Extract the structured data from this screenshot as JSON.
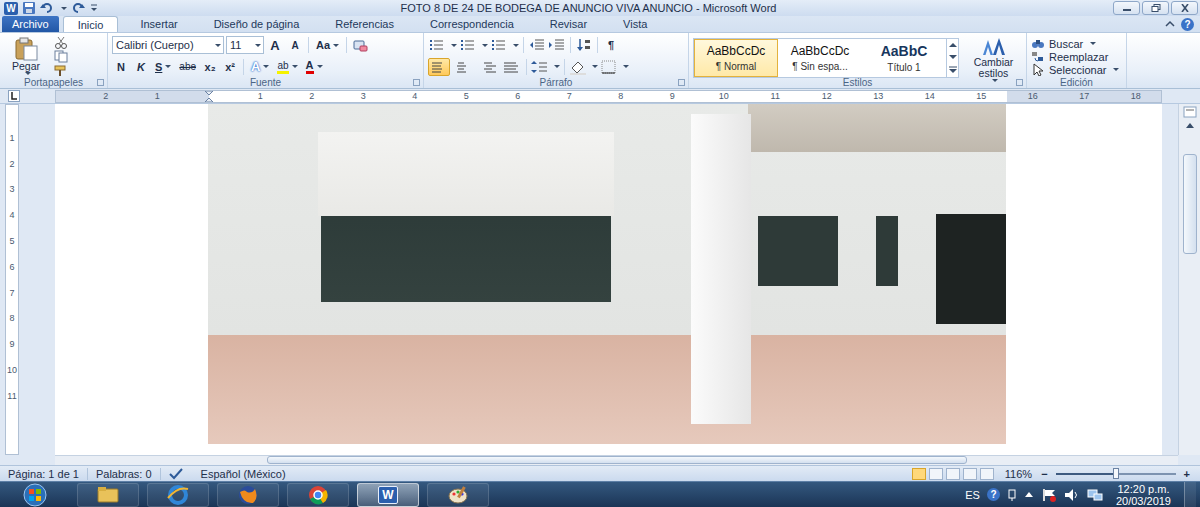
{
  "window": {
    "title": "FOTO 8 DE 24 DE BODEGA DE ANUNCIO VIVA ANUNCIO - Microsoft Word",
    "logo": "W",
    "help": "?"
  },
  "tabs": [
    {
      "label": "Archivo",
      "kind": "file",
      "selected": false
    },
    {
      "label": "Inicio",
      "kind": "tab",
      "selected": true
    },
    {
      "label": "Insertar",
      "kind": "tab",
      "selected": false
    },
    {
      "label": "Diseño de página",
      "kind": "tab",
      "selected": false
    },
    {
      "label": "Referencias",
      "kind": "tab",
      "selected": false
    },
    {
      "label": "Correspondencia",
      "kind": "tab",
      "selected": false
    },
    {
      "label": "Revisar",
      "kind": "tab",
      "selected": false
    },
    {
      "label": "Vista",
      "kind": "tab",
      "selected": false
    }
  ],
  "ribbon": {
    "clipboard": {
      "label": "Portapapeles",
      "paste": "Pegar"
    },
    "font": {
      "label": "Fuente",
      "name": "Calibri (Cuerpo)",
      "size": "11",
      "grow": "A",
      "shrink": "A",
      "case": "Aa",
      "bold": "N",
      "italic": "K",
      "underline": "S",
      "strike": "abe",
      "subscript": "x₂",
      "superscript": "x²",
      "effects": "A",
      "highlight": "ab",
      "color": "A"
    },
    "paragraph": {
      "label": "Párrafo",
      "marks": "¶",
      "align": [
        {
          "selected": true
        },
        {
          "selected": false
        },
        {
          "selected": false
        },
        {
          "selected": false
        }
      ]
    },
    "styles": {
      "label": "Estilos",
      "items": [
        {
          "preview": "AaBbCcDc",
          "name": "¶ Normal",
          "selected": true
        },
        {
          "preview": "AaBbCcDc",
          "name": "¶ Sin espa...",
          "selected": false
        },
        {
          "preview": "AaBbC",
          "name": "Título 1",
          "selected": false
        }
      ],
      "change": "Cambiar estilos"
    },
    "editing": {
      "label": "Edición",
      "find": "Buscar",
      "replace": "Reemplazar",
      "select": "Seleccionar"
    }
  },
  "ruler": {
    "h": [
      "2",
      "1",
      "1",
      "2",
      "3",
      "4",
      "5",
      "6",
      "7",
      "8",
      "9",
      "10",
      "11",
      "12",
      "13",
      "14",
      "15",
      "16",
      "17",
      "18"
    ],
    "v": [
      "1",
      "2",
      "3",
      "4",
      "5",
      "6",
      "7",
      "8",
      "9",
      "10",
      "11"
    ]
  },
  "status_bar": {
    "page": "Página: 1 de 1",
    "words": "Palabras: 0",
    "language": "Español (México)",
    "views": [
      {
        "selected": true
      },
      {
        "selected": false
      },
      {
        "selected": false
      },
      {
        "selected": false
      },
      {
        "selected": false
      }
    ],
    "zoom": "116%",
    "zoom_out": "−",
    "zoom_in": "+",
    "zoom_level": 0.5
  },
  "taskbar": {
    "apps": [
      {
        "kind": "explorer",
        "selected": false
      },
      {
        "kind": "ie",
        "selected": false
      },
      {
        "kind": "firefox",
        "selected": false
      },
      {
        "kind": "chrome",
        "selected": false
      },
      {
        "kind": "word",
        "selected": true,
        "logo": "W"
      },
      {
        "kind": "paint",
        "selected": false
      }
    ],
    "language": "ES",
    "help": "?",
    "time": "12:20 p.m.",
    "date": "20/03/2019"
  }
}
